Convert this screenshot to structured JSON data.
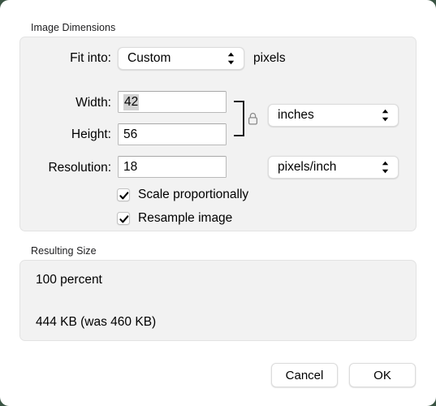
{
  "window": {
    "background_outside": "#3a5443",
    "surface": "#ffffff"
  },
  "image_dimensions": {
    "section_title": "Image Dimensions",
    "fit_into": {
      "label": "Fit into:",
      "value": "Custom",
      "suffix": "pixels"
    },
    "width": {
      "label": "Width:",
      "value": "42",
      "selected": true
    },
    "height": {
      "label": "Height:",
      "value": "56"
    },
    "resolution": {
      "label": "Resolution:",
      "value": "18"
    },
    "units": {
      "value": "inches"
    },
    "resolution_units": {
      "value": "pixels/inch"
    },
    "lock": {
      "icon": "lock-closed-icon",
      "color": "#8a8a8a"
    },
    "scale_proportionally": {
      "label": "Scale proportionally",
      "checked": true
    },
    "resample_image": {
      "label": "Resample image",
      "checked": true
    }
  },
  "resulting_size": {
    "section_title": "Resulting Size",
    "percent_line": "100 percent",
    "size_line": "444 KB (was 460 KB)"
  },
  "buttons": {
    "cancel": "Cancel",
    "ok": "OK"
  }
}
